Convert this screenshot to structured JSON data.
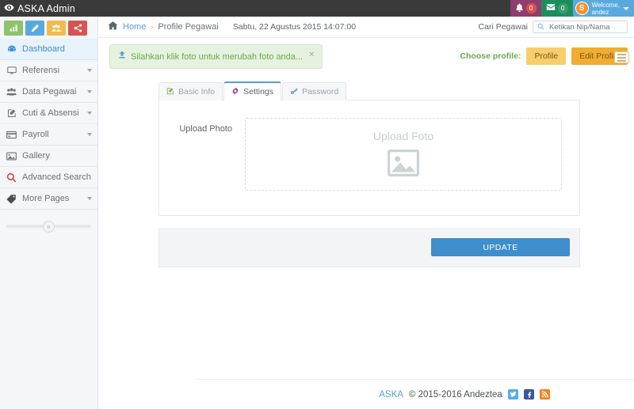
{
  "app": {
    "title": "ASKA Admin",
    "logo_icon": "eye-icon"
  },
  "topbar": {
    "notifications": {
      "icon": "bell-icon",
      "count": "0"
    },
    "messages": {
      "icon": "envelope-icon",
      "count": "0"
    },
    "user": {
      "avatar_initial": "S",
      "welcome_line1": "Welcome,",
      "welcome_line2": "andez",
      "caret_icon": "caret-down-icon"
    }
  },
  "sidebar": {
    "quick_actions": [
      {
        "name": "chart-button",
        "icon": "bar-chart-icon",
        "color": "#8dc36a"
      },
      {
        "name": "edit-button",
        "icon": "pencil-icon",
        "color": "#5aa9dd"
      },
      {
        "name": "users-button",
        "icon": "users-icon",
        "color": "#f5bb4a"
      },
      {
        "name": "share-button",
        "icon": "share-alt-icon",
        "color": "#d9534f"
      }
    ],
    "items": [
      {
        "label": "Dashboard",
        "icon": "dashboard-icon",
        "active": true,
        "expandable": false
      },
      {
        "label": "Referensi",
        "icon": "monitor-icon",
        "active": false,
        "expandable": true
      },
      {
        "label": "Data Pegawai",
        "icon": "users-icon",
        "active": false,
        "expandable": true
      },
      {
        "label": "Cuti & Absensi",
        "icon": "edit-square-icon",
        "active": false,
        "expandable": true
      },
      {
        "label": "Payroll",
        "icon": "credit-card-icon",
        "active": false,
        "expandable": true
      },
      {
        "label": "Gallery",
        "icon": "image-icon",
        "active": false,
        "expandable": false
      },
      {
        "label": "Advanced Search",
        "icon": "search-icon",
        "active": false,
        "expandable": false
      },
      {
        "label": "More Pages",
        "icon": "tag-icon",
        "active": false,
        "expandable": true
      }
    ],
    "collapse_toggle": {
      "icon": "chevron-double-left-icon",
      "glyph": "«"
    }
  },
  "breadcrumb": {
    "home_icon": "home-icon",
    "home_label": "Home",
    "separator": "›",
    "current": "Profile Pegawai",
    "datetime": "Sabtu, 22 Agustus 2015 14:07:00"
  },
  "search": {
    "label": "Cari Pegawai",
    "icon": "search-icon",
    "placeholder": "Ketikan Nip/Nama",
    "value": ""
  },
  "alert": {
    "icon": "upload-icon",
    "message": "Silahkan klik foto untuk merubah foto anda...",
    "close_icon": "close-icon",
    "color": "#6aa84f"
  },
  "profile_switch": {
    "label": "Choose profile:",
    "buttons": [
      {
        "label": "Profile",
        "active": false
      },
      {
        "label": "Edit Profile",
        "active": true
      }
    ],
    "list_icon": "list-icon"
  },
  "tabs": [
    {
      "label": "Basic Info",
      "icon": "edit-square-icon",
      "active": false
    },
    {
      "label": "Settings",
      "icon": "gear-icon",
      "active": true
    },
    {
      "label": "Password",
      "icon": "key-icon",
      "active": false
    }
  ],
  "form": {
    "upload_label": "Upload Photo",
    "dropzone_text": "Upload Foto",
    "dropzone_icon": "image-placeholder-icon",
    "submit_label": "UPDATE"
  },
  "footer": {
    "brand": "ASKA",
    "copyright": "© 2015-2016 Andeztea",
    "social": [
      {
        "name": "twitter-icon",
        "color": "#55acee"
      },
      {
        "name": "facebook-icon",
        "color": "#3b5998"
      },
      {
        "name": "rss-icon",
        "color": "#f5821f"
      }
    ]
  }
}
